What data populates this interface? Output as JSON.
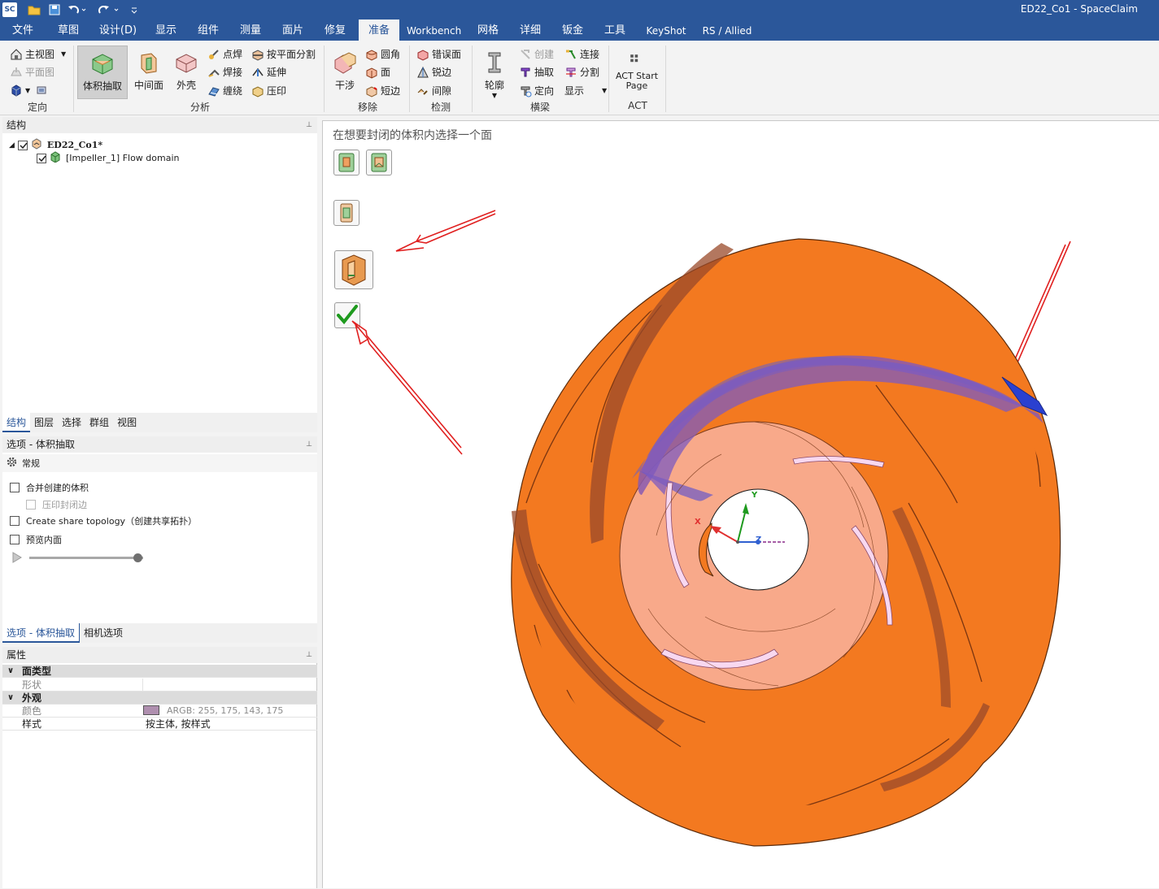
{
  "app": {
    "title": "ED22_Co1 - SpaceClaim",
    "logo": "SC"
  },
  "menu": [
    "文件",
    "草图",
    "设计(D)",
    "显示",
    "组件",
    "测量",
    "面片",
    "修复",
    "准备",
    "Workbench",
    "网格",
    "详细",
    "钣金",
    "工具",
    "KeyShot",
    "RS / Allied"
  ],
  "menu_active": "准备",
  "ribbon": {
    "orient": {
      "label": "定向",
      "main_view": "主视图",
      "plane_view": "平面图"
    },
    "analysis": {
      "label": "分析",
      "volume_extract": "体积抽取",
      "midsurface": "中间面",
      "shell": "外壳",
      "spot_weld": "点焊",
      "weld": "焊接",
      "wrap": "缠绕",
      "split_by_plane": "按平面分割",
      "extend": "延伸",
      "imprint": "压印"
    },
    "remove": {
      "label": "移除",
      "interference": "干涉",
      "round": "圆角",
      "face": "面",
      "short_edge": "短边"
    },
    "detect": {
      "label": "检测",
      "error_face": "错误面",
      "sharp_edge": "锐边",
      "gap": "间隙"
    },
    "beam": {
      "label": "横梁",
      "profile": "轮廓",
      "create": "创建",
      "extract": "抽取",
      "orient": "定向",
      "connect": "连接",
      "split": "分割",
      "display": "显示"
    },
    "act": {
      "label": "ACT",
      "start_l1": "ACT Start",
      "start_l2": "Page"
    }
  },
  "structure": {
    "header": "结构",
    "root": "ED22_Co1*",
    "child": "[Impeller_1] Flow domain"
  },
  "structure_tabs": [
    "结构",
    "图层",
    "选择",
    "群组",
    "视图"
  ],
  "options": {
    "header": "选项 - 体积抽取",
    "section": "常规",
    "merge": "合并创建的体积",
    "imprint_edge": "压印封闭边",
    "share_topology": "Create share topology（创建共享拓扑）",
    "preview": "预览内面",
    "slider_value": 1.0
  },
  "options_tabs": [
    "选项 - 体积抽取",
    "相机选项"
  ],
  "properties": {
    "header": "属性",
    "group1": "面类型",
    "shape_key": "形状",
    "shape_val": "",
    "group2": "外观",
    "color_key": "颜色",
    "color_val": "ARGB: 255, 175, 143, 175",
    "color_swatch": "#af8faf",
    "style_key": "样式",
    "style_val": "按主体, 按样式"
  },
  "viewport": {
    "prompt": "在想要封闭的体积内选择一个面",
    "axes": {
      "x": "X",
      "y": "Y",
      "z": "Z"
    }
  }
}
